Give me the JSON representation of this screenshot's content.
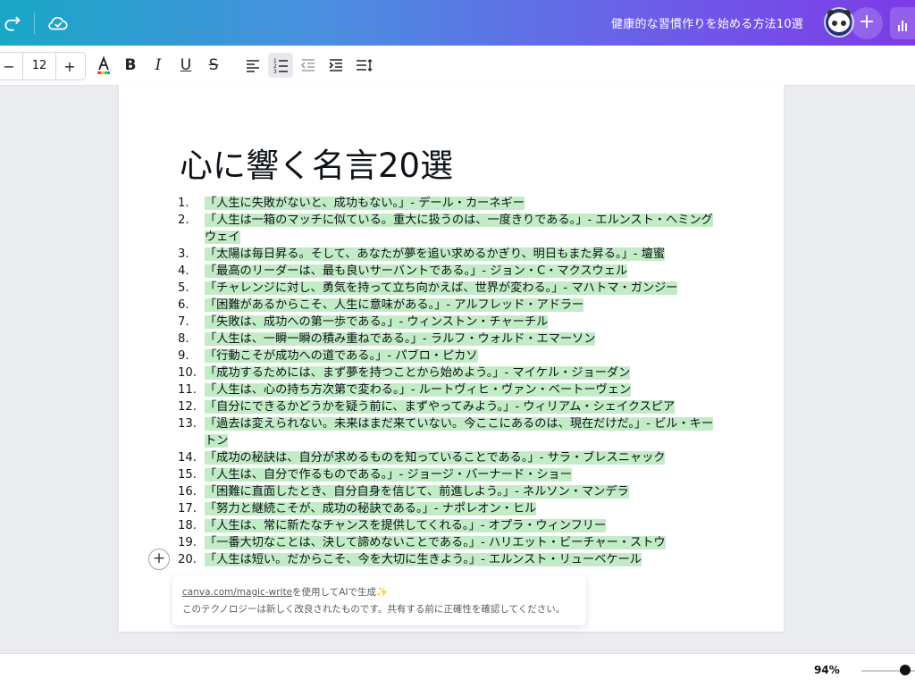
{
  "header": {
    "doc_title": "健康的な習慣作りを始める方法10選"
  },
  "toolbar": {
    "font_size": "12"
  },
  "document": {
    "heading": "心に響く名言20選",
    "items": [
      {
        "num": "1.",
        "text": "「人生に失敗がないと、成功もない。」- デール・カーネギー"
      },
      {
        "num": "2.",
        "text": "「人生は一箱のマッチに似ている。重大に扱うのは、一度きりである。」- エルンスト・ヘミングウェイ"
      },
      {
        "num": "3.",
        "text": "「太陽は毎日昇る。そして、あなたが夢を追い求めるかぎり、明日もまた昇る。」- 壇蜜"
      },
      {
        "num": "4.",
        "text": "「最高のリーダーは、最も良いサーバントである。」- ジョン・C・マクスウェル"
      },
      {
        "num": "5.",
        "text": "「チャレンジに対し、勇気を持って立ち向かえば、世界が変わる。」- マハトマ・ガンジー"
      },
      {
        "num": "6.",
        "text": "「困難があるからこそ、人生に意味がある。」- アルフレッド・アドラー"
      },
      {
        "num": "7.",
        "text": "「失敗は、成功への第一歩である。」- ウィンストン・チャーチル"
      },
      {
        "num": "8.",
        "text": "「人生は、一瞬一瞬の積み重ねである。」- ラルフ・ウォルド・エマーソン"
      },
      {
        "num": "9.",
        "text": "「行動こそが成功への道である。」- パブロ・ピカソ"
      },
      {
        "num": "10.",
        "text": "「成功するためには、まず夢を持つことから始めよう。」- マイケル・ジョーダン"
      },
      {
        "num": "11.",
        "text": "「人生は、心の持ち方次第で変わる。」- ルートヴィヒ・ヴァン・ベートーヴェン"
      },
      {
        "num": "12.",
        "text": "「自分にできるかどうかを疑う前に、まずやってみよう。」- ウィリアム・シェイクスピア"
      },
      {
        "num": "13.",
        "text": "「過去は変えられない。未来はまだ来ていない。今ここにあるのは、現在だけだ。」- ビル・キートン"
      },
      {
        "num": "14.",
        "text": "「成功の秘訣は、自分が求めるものを知っていることである。」- サラ・ブレスニャック"
      },
      {
        "num": "15.",
        "text": "「人生は、自分で作るものである。」- ジョージ・バーナード・ショー"
      },
      {
        "num": "16.",
        "text": "「困難に直面したとき、自分自身を信じて、前進しよう。」- ネルソン・マンデラ"
      },
      {
        "num": "17.",
        "text": "「努力と継続こそが、成功の秘訣である。」- ナポレオン・ヒル"
      },
      {
        "num": "18.",
        "text": "「人生は、常に新たなチャンスを提供してくれる。」- オプラ・ウィンフリー"
      },
      {
        "num": "19.",
        "text": "「一番大切なことは、決して諦めないことである。」- ハリエット・ビーチャー・ストウ"
      },
      {
        "num": "20.",
        "text": "「人生は短い。だからこそ、今を大切に生きよう。」- エルンスト・リューベケール"
      }
    ]
  },
  "notice": {
    "link": "canva.com/magic-write",
    "link_suffix": "を使用してAIで生成",
    "sparkle": "✨",
    "disclaimer": "このテクノロジーは新しく改良されたものです。共有する前に正確性を確認してください。"
  },
  "footer": {
    "zoom": "94%",
    "zoom_value_percent": 94
  },
  "colors": {
    "highlight": "#c2ecc6",
    "header_gradient_start": "#19a7c6",
    "header_gradient_end": "#7d3be6"
  }
}
